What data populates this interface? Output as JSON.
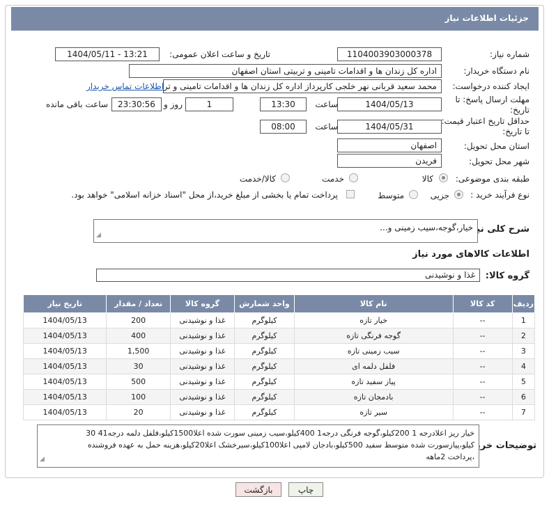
{
  "header": {
    "title": "جزئیات اطلاعات نیاز"
  },
  "fields": {
    "need_number_label": "شماره نیاز:",
    "need_number": "1104003903000378",
    "announce_label": "تاریخ و ساعت اعلان عمومی:",
    "announce_value": "1404/05/11 - 13:21",
    "buyer_label": "نام دستگاه خریدار:",
    "buyer_value": "اداره کل زندان ها و اقدامات تامینی و تربیتی استان اصفهان",
    "creator_label": "ایجاد کننده درخواست:",
    "creator_value": "محمد سعید قربانی نهر خلجی کارپرداز اداره کل زندان ها و اقدامات تامینی و تربیتی",
    "contact_link": "اطلاعات تماس خریدار",
    "reply_deadline_label": "مهلت ارسال پاسخ: تا تاریخ:",
    "reply_date": "1404/05/13",
    "time_label": "ساعت",
    "reply_time": "13:30",
    "days_value": "1",
    "days_label": "روز و",
    "remaining_time": "23:30:56",
    "remaining_label": "ساعت باقی مانده",
    "price_validity_label": "حداقل تاریخ اعتبار قیمت: تا تاریخ:",
    "price_date": "1404/05/31",
    "price_time": "08:00",
    "province_label": "استان محل تحویل:",
    "province_value": "اصفهان",
    "city_label": "شهر محل تحویل:",
    "city_value": "فریدن",
    "category_label": "طبقه بندی موضوعی:",
    "category_options": [
      "کالا",
      "خدمت",
      "کالا/خدمت"
    ],
    "process_label": "نوع فرآیند خرید :",
    "process_options": [
      "جزیی",
      "متوسط"
    ],
    "payment_note": "پرداخت تمام یا بخشی از مبلغ خرید،از محل \"اسناد خزانه اسلامی\" خواهد بود."
  },
  "description": {
    "label": "شرح کلی نیاز:",
    "value": "خیار،گوجه،سیب زمینی و..."
  },
  "goods": {
    "section_title": "اطلاعات کالاهای مورد نیاز",
    "group_label": "گروه کالا:",
    "group_value": "غذا و نوشیدنی",
    "columns": [
      "ردیف",
      "کد کالا",
      "نام کالا",
      "واحد شمارش",
      "گروه کالا",
      "تعداد / مقدار",
      "تاریخ نیاز"
    ],
    "rows": [
      [
        "1",
        "--",
        "خیار تازه",
        "کیلوگرم",
        "غذا و نوشیدنی",
        "200",
        "1404/05/13"
      ],
      [
        "2",
        "--",
        "گوجه فرنگی تازه",
        "کیلوگرم",
        "غذا و نوشیدنی",
        "400",
        "1404/05/13"
      ],
      [
        "3",
        "--",
        "سیب زمینی تازه",
        "کیلوگرم",
        "غذا و نوشیدنی",
        "1,500",
        "1404/05/13"
      ],
      [
        "4",
        "--",
        "فلفل دلمه ای",
        "کیلوگرم",
        "غذا و نوشیدنی",
        "30",
        "1404/05/13"
      ],
      [
        "5",
        "--",
        "پیاز سفید تازه",
        "کیلوگرم",
        "غذا و نوشیدنی",
        "500",
        "1404/05/13"
      ],
      [
        "6",
        "--",
        "بادمجان تازه",
        "کیلوگرم",
        "غذا و نوشیدنی",
        "100",
        "1404/05/13"
      ],
      [
        "7",
        "--",
        "سیر تازه",
        "کیلوگرم",
        "غذا و نوشیدنی",
        "20",
        "1404/05/13"
      ]
    ]
  },
  "buyer_notes": {
    "label": "توضیحات خریدار:",
    "line1": "خیار ریز اعلادرجه 1 200کیلو،گوجه فرنگی درجه1 400کیلو،سیب زمینی سورت شده اعلا1500کیلو،فلفل دلمه درجه41 30",
    "line2": "کیلو،پیازسورت شده متوسط سفید 500کیلو،بادجان لامپی اعلا100کیلو،سیرخشک اعلا20کیلو،هزینه حمل به عهده فروشنده",
    "line3": "،پرداخت 2ماهه"
  },
  "buttons": {
    "print": "چاپ",
    "back": "بازگشت"
  }
}
